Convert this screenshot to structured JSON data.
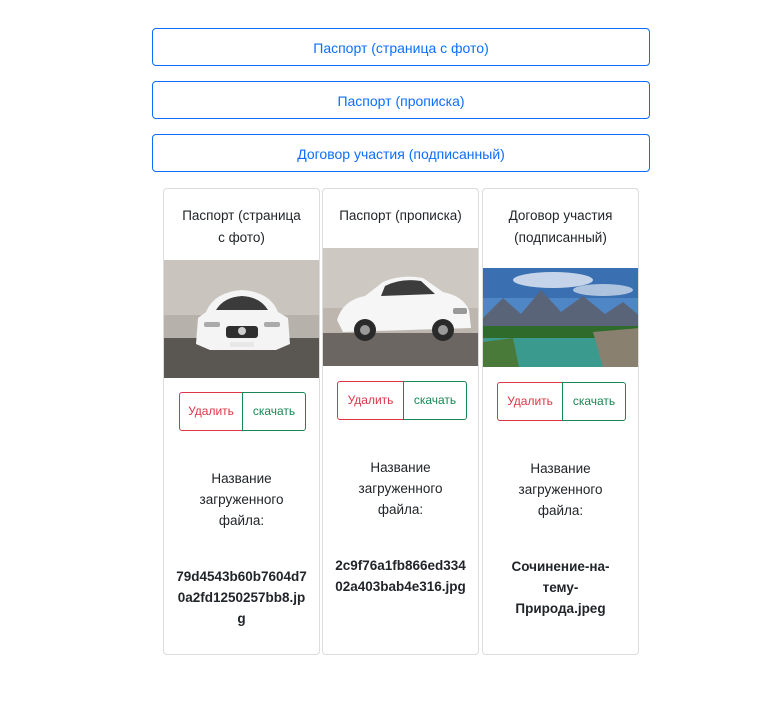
{
  "upload_buttons": [
    {
      "label": "Паспорт (страница с фото)"
    },
    {
      "label": "Паспорт (прописка)"
    },
    {
      "label": "Договор участия (подписанный)"
    }
  ],
  "cards": [
    {
      "title": "Паспорт (страница с фото)",
      "image": "car-photo-front",
      "delete_label": "Удалить",
      "download_label": "скачать",
      "filename_label": "Название загруженного файла:",
      "filename": "79d4543b60b7604d70a2fd1250257bb8.jpg"
    },
    {
      "title": "Паспорт (прописка)",
      "image": "car-photo-side",
      "delete_label": "Удалить",
      "download_label": "скачать",
      "filename_label": "Название загруженного файла:",
      "filename": "2c9f76a1fb866ed33402a403bab4e316.jpg"
    },
    {
      "title": "Договор участия (подписанный)",
      "image": "nature-landscape",
      "delete_label": "Удалить",
      "download_label": "скачать",
      "filename_label": "Название загруженного файла:",
      "filename": "Сочинение-на-тему-Природа.jpeg"
    }
  ],
  "colors": {
    "primary": "#0d6efd",
    "danger": "#dc3545",
    "success": "#198754"
  }
}
